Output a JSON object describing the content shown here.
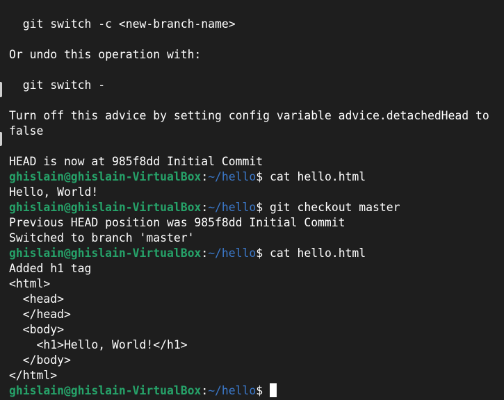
{
  "terminal": {
    "prompt": {
      "user_host": "ghislain@ghislain-VirtualBox",
      "colon": ":",
      "path": "~/hello",
      "dollar": "$"
    },
    "lines": [
      {
        "type": "out",
        "text": "  git switch -c <new-branch-name>"
      },
      {
        "type": "out",
        "text": ""
      },
      {
        "type": "out",
        "text": "Or undo this operation with:"
      },
      {
        "type": "out",
        "text": ""
      },
      {
        "type": "out",
        "text": "  git switch -"
      },
      {
        "type": "out",
        "text": ""
      },
      {
        "type": "out",
        "text": "Turn off this advice by setting config variable advice.detachedHead to"
      },
      {
        "type": "out",
        "text": "false"
      },
      {
        "type": "out",
        "text": ""
      },
      {
        "type": "out",
        "text": "HEAD is now at 985f8dd Initial Commit"
      },
      {
        "type": "prompt",
        "command": " cat hello.html"
      },
      {
        "type": "out",
        "text": "Hello, World!"
      },
      {
        "type": "prompt",
        "command": " git checkout master"
      },
      {
        "type": "out",
        "text": "Previous HEAD position was 985f8dd Initial Commit"
      },
      {
        "type": "out",
        "text": "Switched to branch 'master'"
      },
      {
        "type": "prompt",
        "command": " cat hello.html"
      },
      {
        "type": "out",
        "text": "Added h1 tag"
      },
      {
        "type": "out",
        "text": "<html>"
      },
      {
        "type": "out",
        "text": "  <head>"
      },
      {
        "type": "out",
        "text": "  </head>"
      },
      {
        "type": "out",
        "text": "  <body>"
      },
      {
        "type": "out",
        "text": "    <h1>Hello, World!</h1>"
      },
      {
        "type": "out",
        "text": "  </body>"
      },
      {
        "type": "out",
        "text": "</html>"
      },
      {
        "type": "prompt",
        "command": " ",
        "cursor": true
      }
    ]
  }
}
